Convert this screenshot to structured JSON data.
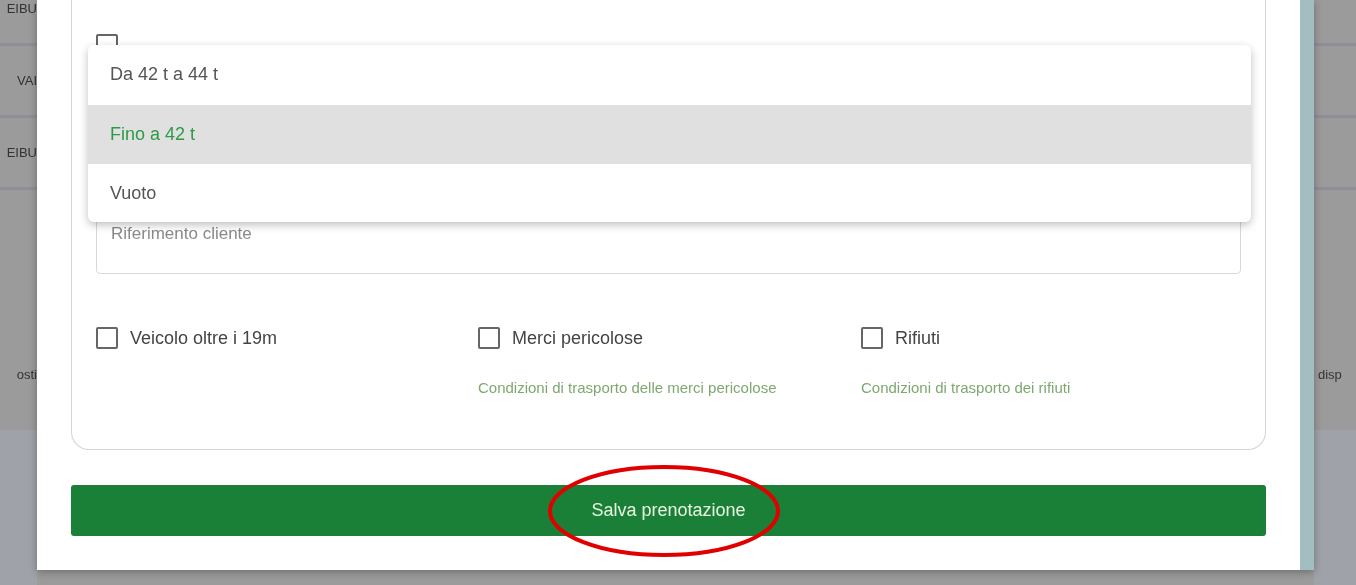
{
  "background_page": {
    "left_texts": [
      "EIBU",
      "VAI",
      "EIBU",
      "osti"
    ],
    "right_texts": [
      "disp"
    ]
  },
  "form": {
    "hidden_checkbox": {
      "checked": false
    },
    "reference_field": {
      "placeholder": "Riferimento cliente"
    },
    "weight_options": [
      {
        "label": "Da 42 t a 44 t",
        "selected": false
      },
      {
        "label": "Fino a 42 t",
        "selected": true
      },
      {
        "label": "Vuoto",
        "selected": false
      }
    ],
    "checkboxes": [
      {
        "label": "Veicolo oltre i 19m",
        "checked": false
      },
      {
        "label": "Merci pericolose",
        "checked": false,
        "link": "Condizioni di trasporto delle merci pericolose"
      },
      {
        "label": "Rifiuti",
        "checked": false,
        "link": "Condizioni di trasporto dei rifiuti"
      }
    ]
  },
  "save_button": {
    "label": "Salva prenotazione"
  },
  "annotations": [
    {
      "kind": "ellipse",
      "color": "#e00000"
    }
  ]
}
